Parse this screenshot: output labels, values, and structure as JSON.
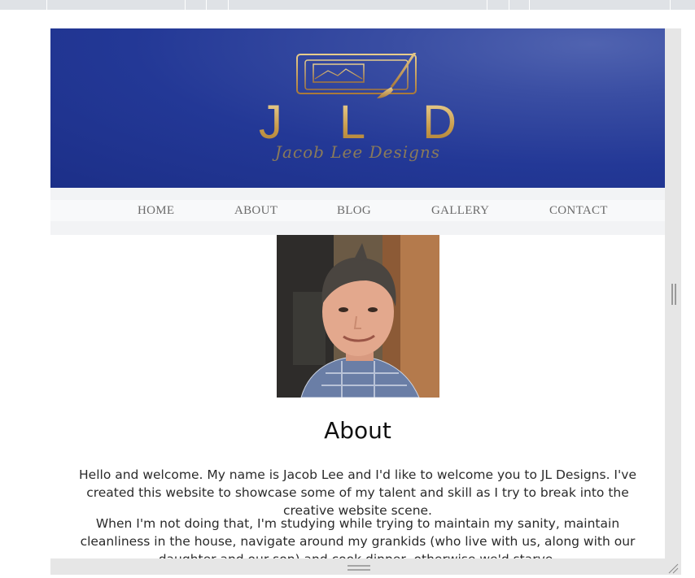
{
  "header": {
    "logo_letters": "JLD",
    "tagline": "Jacob Lee Designs"
  },
  "nav": {
    "items": [
      "HOME",
      "ABOUT",
      "BLOG",
      "GALLERY",
      "CONTACT"
    ]
  },
  "about": {
    "heading": "About",
    "paragraph_1": "Hello and welcome. My name is Jacob Lee and I'd like to welcome you to JL Designs. I've created this website to showcase some of my talent and skill as I try to break into the creative website scene.",
    "paragraph_2": "When I'm not doing that, I'm studying while trying to maintain my sanity, maintain cleanliness in the house, navigate around my grankids (who live with us, along with our daughter and our son) and cook dinner, otherwise we'd starve."
  },
  "colors": {
    "banner": "#233896",
    "logo_gold": "#c89b4a",
    "nav_bg": "#f2f3f5",
    "nav_text": "#6b6b6b"
  }
}
